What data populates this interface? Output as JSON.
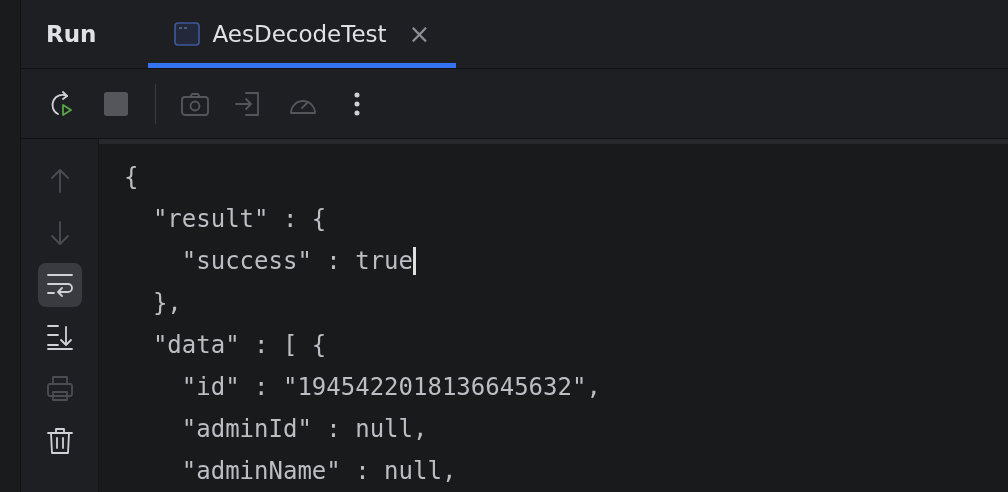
{
  "panel": {
    "title": "Run"
  },
  "tabs": [
    {
      "label": "AesDecodeTest",
      "selected": true,
      "close": "×"
    }
  ],
  "toolbar": [
    {
      "kind": "rerun",
      "disabled": false
    },
    {
      "kind": "stop",
      "disabled": true
    },
    {
      "kind": "camera",
      "disabled": true
    },
    {
      "kind": "enter",
      "disabled": true
    },
    {
      "kind": "gauge",
      "disabled": true
    },
    {
      "kind": "more",
      "disabled": false
    }
  ],
  "side_tools": [
    {
      "kind": "up",
      "disabled": true,
      "selected": false
    },
    {
      "kind": "down",
      "disabled": true,
      "selected": false
    },
    {
      "kind": "wrap",
      "disabled": false,
      "selected": true
    },
    {
      "kind": "scroll-end",
      "disabled": false,
      "selected": false
    },
    {
      "kind": "print",
      "disabled": true,
      "selected": false
    },
    {
      "kind": "trash",
      "disabled": false,
      "selected": false
    }
  ],
  "console": {
    "lines": [
      {
        "text": "{",
        "cursor": false
      },
      {
        "text": "  \"result\" : {",
        "cursor": false
      },
      {
        "text": "    \"success\" : true",
        "cursor": true
      },
      {
        "text": "  },",
        "cursor": false
      },
      {
        "text": "  \"data\" : [ {",
        "cursor": false
      },
      {
        "text": "    \"id\" : \"1945422018136645632\",",
        "cursor": false
      },
      {
        "text": "    \"adminId\" : null,",
        "cursor": false
      },
      {
        "text": "    \"adminName\" : null,",
        "cursor": false
      }
    ]
  }
}
